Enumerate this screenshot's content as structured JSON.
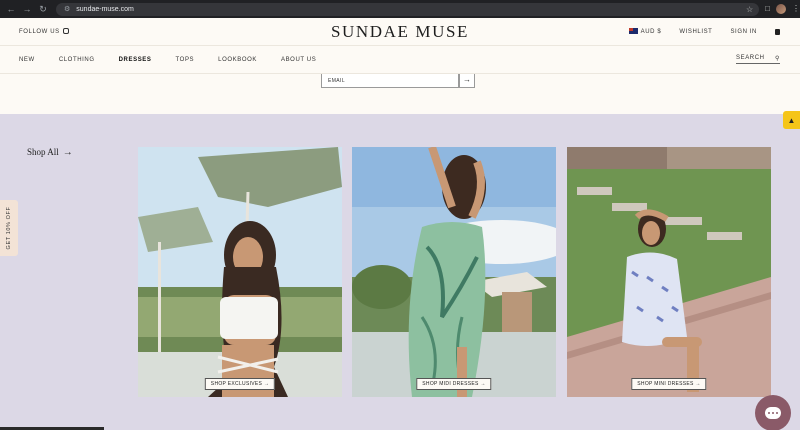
{
  "browser": {
    "url": "sundae-muse.com"
  },
  "header": {
    "follow_label": "FOLLOW US",
    "logo": "SUNDAE MUSE",
    "currency": "AUD $",
    "wishlist": "WISHLIST",
    "signin": "SIGN IN"
  },
  "nav": {
    "items": [
      {
        "label": "NEW"
      },
      {
        "label": "CLOTHING"
      },
      {
        "label": "DRESSES"
      },
      {
        "label": "TOPS"
      },
      {
        "label": "LOOKBOOK"
      },
      {
        "label": "ABOUT US"
      }
    ],
    "search_label": "SEARCH"
  },
  "newsletter": {
    "email_placeholder": "EMAIL"
  },
  "main": {
    "shop_all": "Shop All",
    "tiles": [
      {
        "button": "SHOP EXCLUSIVES"
      },
      {
        "button": "SHOP MIDI DRESSES"
      },
      {
        "button": "SHOP MINI DRESSES"
      }
    ]
  },
  "side_tab": {
    "label": "GET 10% OFF"
  },
  "colors": {
    "page_bg": "#dcd8e6",
    "header_bg": "#fdfaf5",
    "chat": "#8a5a68",
    "badge": "#f5c518"
  }
}
